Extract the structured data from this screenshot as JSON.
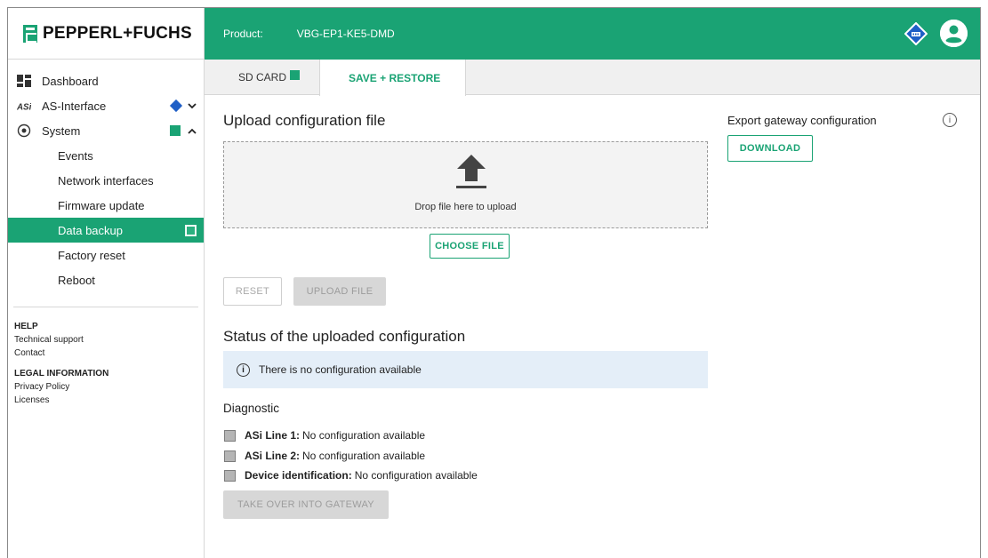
{
  "brand": {
    "logo_text": "PEPPERL+FUCHS"
  },
  "colors": {
    "accent": "#1aa374",
    "as_interface_status": "#1f5fc6",
    "info_bg": "#e4eef8"
  },
  "sidebar": {
    "items": [
      {
        "label": "Dashboard",
        "icon": "dashboard-icon"
      },
      {
        "label": "AS-Interface",
        "icon": "asi-icon",
        "status": "blue-diamond",
        "expand": "chevron-down"
      },
      {
        "label": "System",
        "icon": "system-icon",
        "status": "green-square",
        "expand": "chevron-up"
      },
      {
        "label": "Events"
      },
      {
        "label": "Network interfaces"
      },
      {
        "label": "Firmware update"
      },
      {
        "label": "Data backup",
        "active": true
      },
      {
        "label": "Factory reset"
      },
      {
        "label": "Reboot"
      }
    ],
    "help": {
      "header": "HELP",
      "links": [
        "Technical support",
        "Contact"
      ]
    },
    "legal": {
      "header": "LEGAL INFORMATION",
      "links": [
        "Privacy Policy",
        "Licenses"
      ]
    }
  },
  "header": {
    "product_label": "Product:",
    "product_value": "VBG-EP1-KE5-DMD"
  },
  "tabs": [
    {
      "label": "SD CARD",
      "status": "green-square"
    },
    {
      "label": "SAVE + RESTORE",
      "active": true
    }
  ],
  "upload": {
    "title": "Upload configuration file",
    "drop_text": "Drop file here to upload",
    "choose_file": "CHOOSE FILE",
    "reset": "RESET",
    "upload_file": "UPLOAD FILE"
  },
  "status": {
    "title": "Status of the uploaded configuration",
    "info_text": "There is no configuration available"
  },
  "diagnostic": {
    "title": "Diagnostic",
    "rows": [
      {
        "label": "ASi Line 1:",
        "value": "No configuration available"
      },
      {
        "label": "ASi Line 2:",
        "value": "No configuration available"
      },
      {
        "label": "Device identification:",
        "value": "No configuration available"
      }
    ],
    "take_over": "TAKE OVER INTO GATEWAY"
  },
  "export": {
    "title": "Export gateway configuration",
    "download": "DOWNLOAD"
  }
}
